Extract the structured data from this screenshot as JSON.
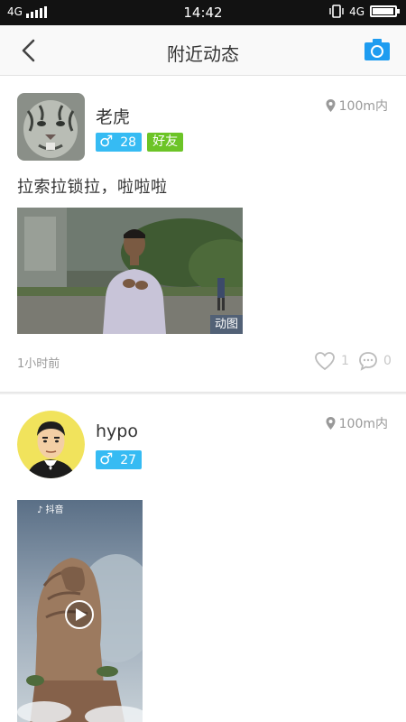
{
  "status_bar": {
    "network": "4G",
    "network_right": "4G",
    "time": "14:42",
    "battery_level": 0.95
  },
  "nav": {
    "title": "附近动态",
    "icons": [
      "chevron-left-icon",
      "camera-icon"
    ],
    "accent_color": "#1e9cf0"
  },
  "posts": [
    {
      "username": "老虎",
      "age": "28",
      "gender_symbol": "♂",
      "friend_badge": "好友",
      "distance": "100m内",
      "text": "拉索拉锁拉，啦啦啦",
      "media_tag": "动图",
      "time": "1小时前",
      "likes": "1",
      "comments": "0"
    },
    {
      "username": "hypo",
      "age": "27",
      "gender_symbol": "♂",
      "distance": "100m内",
      "video_watermark": "♪ 抖音"
    }
  ],
  "colors": {
    "gender_badge": "#36bbf3",
    "friend_badge": "#6cc427",
    "muted_text": "#999999"
  }
}
